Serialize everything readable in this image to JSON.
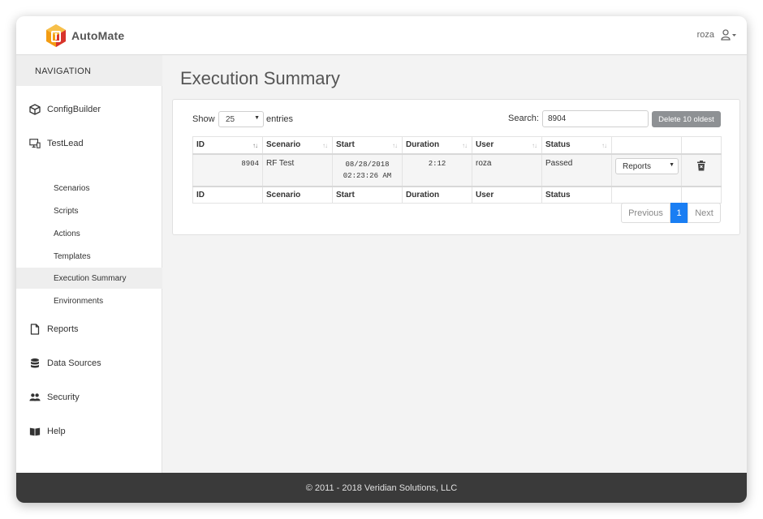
{
  "app": {
    "brand": "AutoMate"
  },
  "user": {
    "name": "roza"
  },
  "sidebar": {
    "header": "NAVIGATION",
    "items": [
      {
        "label": "ConfigBuilder",
        "icon": "cube-icon"
      },
      {
        "label": "TestLead",
        "icon": "monitor-icon"
      },
      {
        "label": "Reports",
        "icon": "file-icon"
      },
      {
        "label": "Data Sources",
        "icon": "database-icon"
      },
      {
        "label": "Security",
        "icon": "users-icon"
      },
      {
        "label": "Help",
        "icon": "book-icon"
      }
    ],
    "testlead_sub": [
      "Scenarios",
      "Scripts",
      "Actions",
      "Templates",
      "Execution Summary",
      "Environments"
    ],
    "active_sub": "Execution Summary"
  },
  "main": {
    "title": "Execution Summary",
    "show_label": "Show",
    "page_length": "25",
    "entries_label": "entries",
    "search_label": "Search:",
    "search_value": "8904",
    "delete_button": "Delete 10 oldest",
    "columns": [
      "ID",
      "Scenario",
      "Start",
      "Duration",
      "User",
      "Status"
    ],
    "rows": [
      {
        "id": "8904",
        "scenario": "RF Test",
        "start_date": "08/28/2018",
        "start_time": "02:23:26 AM",
        "duration": "2:12",
        "user": "roza",
        "status": "Passed",
        "action": "Reports"
      }
    ],
    "pagination": {
      "previous": "Previous",
      "current": "1",
      "next": "Next"
    }
  },
  "footer": {
    "text": "© 2011 - 2018 Veridian Solutions, LLC"
  },
  "colors": {
    "accent": "#1a7ef3",
    "footer_bg": "#3a3a3a",
    "delete_btn": "#8e9194",
    "logo_orange": "#f39c12",
    "logo_red": "#d8342c"
  }
}
